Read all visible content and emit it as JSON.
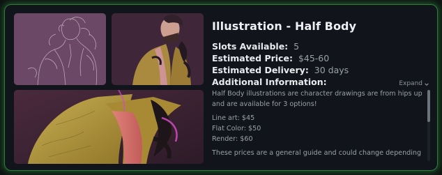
{
  "commission": {
    "title": "Illustration - Half Body",
    "slots_label": "Slots Available:",
    "slots_value": "5",
    "price_label": "Estimated Price:",
    "price_value": "$45-60",
    "delivery_label": "Estimated Delivery:",
    "delivery_value": "30 days",
    "additional_label": "Additional Information:",
    "expand_label": "Expand",
    "description": {
      "intro": "Half Body illustrations are character drawings are from hips up and are available for 3 options!",
      "prices": [
        "Line art: $45",
        "Flat Color: $50",
        "Render: $60"
      ],
      "note": "These prices are a general guide and could change depending"
    }
  },
  "colors": {
    "accent_border": "#2f7d3c",
    "card_bg": "#11151b"
  },
  "icons": {
    "expand": "chevron-down-icon"
  }
}
